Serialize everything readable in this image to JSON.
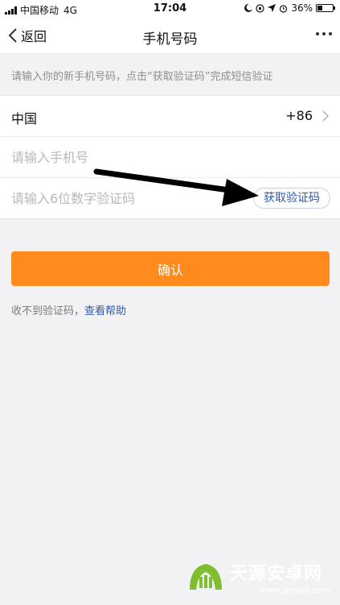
{
  "status_bar": {
    "carrier": "中国移动",
    "network": "4G",
    "time": "17:04",
    "battery": "36%",
    "battery_level": 0.36
  },
  "nav": {
    "back_label": "返回",
    "title": "手机号码"
  },
  "hint": "请输入你的新手机号码，点击“获取验证码”完成短信验证",
  "form": {
    "country_label": "中国",
    "country_code": "+86",
    "phone_placeholder": "请输入手机号",
    "code_placeholder": "请输入6位数字验证码",
    "get_code_label": "获取验证码"
  },
  "confirm_label": "确认",
  "help": {
    "prefix": "收不到验证码，",
    "link": "查看帮助"
  },
  "watermark": {
    "name": "天源安卓网",
    "url": "www.jytyaz.com"
  },
  "colors": {
    "accent": "#ff8a1e",
    "link": "#2f5aa8",
    "background": "#f2f2f4"
  }
}
